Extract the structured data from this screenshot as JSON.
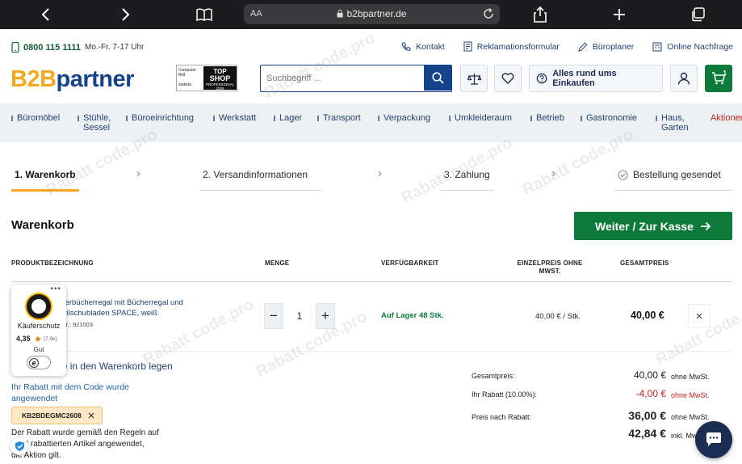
{
  "browser": {
    "url": "b2bpartner.de",
    "aa": "AA"
  },
  "info": {
    "phone": "0800 115 1111",
    "hours": "Mo.-Fr. 7-17 Uhr",
    "links": [
      "Kontakt",
      "Reklamationsformular",
      "Büroplaner",
      "Online Nachfrage"
    ]
  },
  "header": {
    "logo_a": "B2B",
    "logo_b": "partner",
    "badge_small": "Computer Bild",
    "badge_small2": "statista",
    "badge_t1": "TOP",
    "badge_t2": "SHOP",
    "badge_t3": "PROFESSIONAL",
    "badge_year": "2026",
    "search_placeholder": "Suchbegriff ...",
    "alles_label": "Alles rund ums Einkaufen",
    "cart_count": "1"
  },
  "categories": [
    "Büromöbel",
    "Stühle,\nSessel",
    "Büroeinrichtung",
    "Werkstatt",
    "Lager",
    "Transport",
    "Verpackung",
    "Umkleideraum",
    "Betrieb",
    "Gastronomie",
    "Haus,\nGarten",
    "Aktionen"
  ],
  "steps": [
    "1. Warenkorb",
    "2. Versandinformationen",
    "3. Zahlung",
    "Bestellung gesendet"
  ],
  "cart": {
    "title": "Warenkorb",
    "checkout_label": "Weiter / Zur Kasse",
    "columns": [
      "PRODUKTBEZEICHNUNG",
      "MENGE",
      "VERFÜGBARKEIT",
      "EINZELPREIS OHNE MWST.",
      "GESAMTPREIS"
    ],
    "item": {
      "name": "nderbücherregal mit Bücherregal und\nextilschubladen SPACE, weiß",
      "art": "t. Nr.: 921003",
      "qty": "1",
      "availability": "Auf Lager 48 Stk.",
      "unit_price": "40,00 € / Stk.",
      "total": "40,00 €"
    }
  },
  "trust": {
    "label": "Käuferschutz",
    "score": "4,35",
    "count": "(7.9k)",
    "rating": "Gut"
  },
  "coupon": {
    "title": "hte per Code in den Warenkorb legen",
    "link": "Ihr Rabatt mit dem Code wurde angewendet",
    "code": "KB2BDEGMC2608",
    "note": "Der Rabatt wurde gemäß den Regeln auf\n    nicht rabattierten Artikel angewendet,\n    die Aktion gilt."
  },
  "totals": {
    "gesamt_label": "Gesamtpreis:",
    "gesamt_val": "40,00 €",
    "gesamt_suf": "ohne MwSt.",
    "rabatt_label": "Ihr Rabatt (10.00%):",
    "rabatt_val": "-4,00 €",
    "rabatt_suf": "ohne MwSt.",
    "nach_label": "Preis nach Rabatt:",
    "nach_val": "36,00 €",
    "nach_suf": "ohne MwSt.",
    "inkl_val": "42,84 €",
    "inkl_suf": "inkl. Mw"
  },
  "watermark": "Rabatt code.pro",
  "colors": {
    "brand_blue": "#16448a",
    "brand_orange": "#f4a81d",
    "green": "#0e7a3a",
    "red": "#c42222"
  }
}
